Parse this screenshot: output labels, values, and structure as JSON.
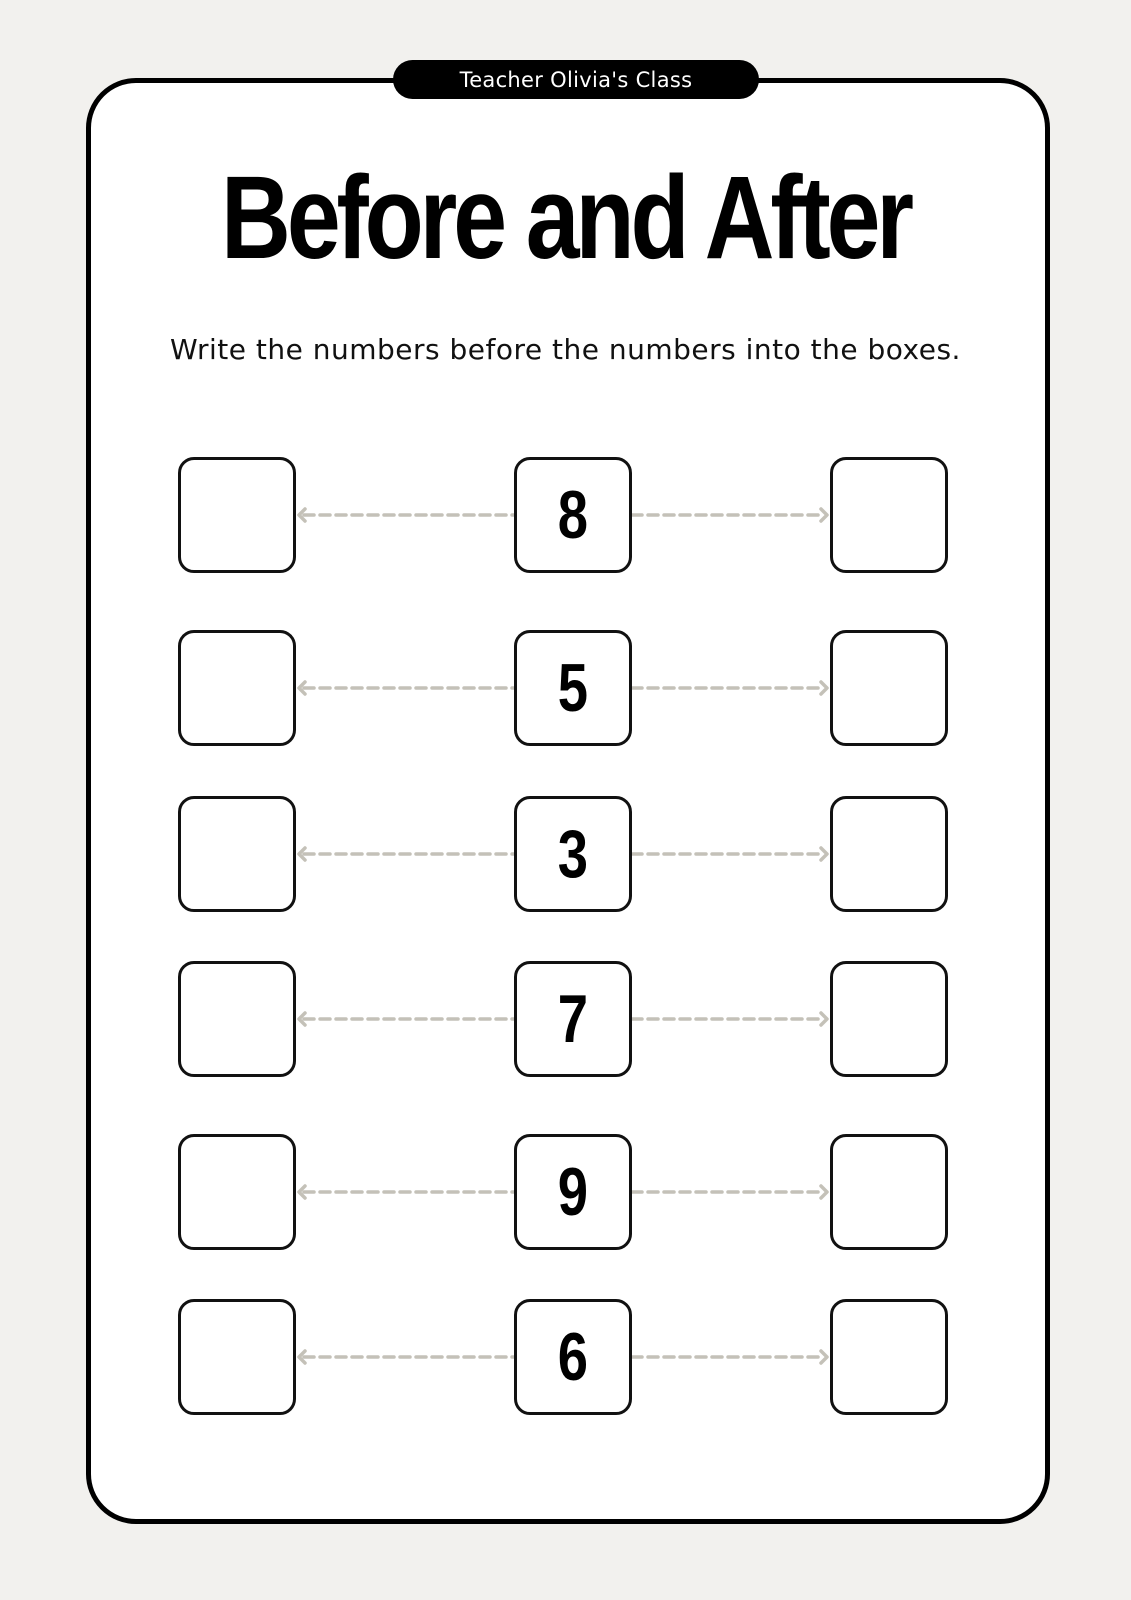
{
  "header": {
    "class_label": "Teacher Olivia's Class",
    "title": "Before and After",
    "instructions": "Write the numbers before the numbers into the boxes."
  },
  "colors": {
    "background": "#f2f1ee",
    "card": "#ffffff",
    "border": "#000000",
    "arrow": "#c4c1b8"
  },
  "rows": [
    {
      "before": "",
      "number": "8",
      "after": ""
    },
    {
      "before": "",
      "number": "5",
      "after": ""
    },
    {
      "before": "",
      "number": "3",
      "after": ""
    },
    {
      "before": "",
      "number": "7",
      "after": ""
    },
    {
      "before": "",
      "number": "9",
      "after": ""
    },
    {
      "before": "",
      "number": "6",
      "after": ""
    }
  ]
}
